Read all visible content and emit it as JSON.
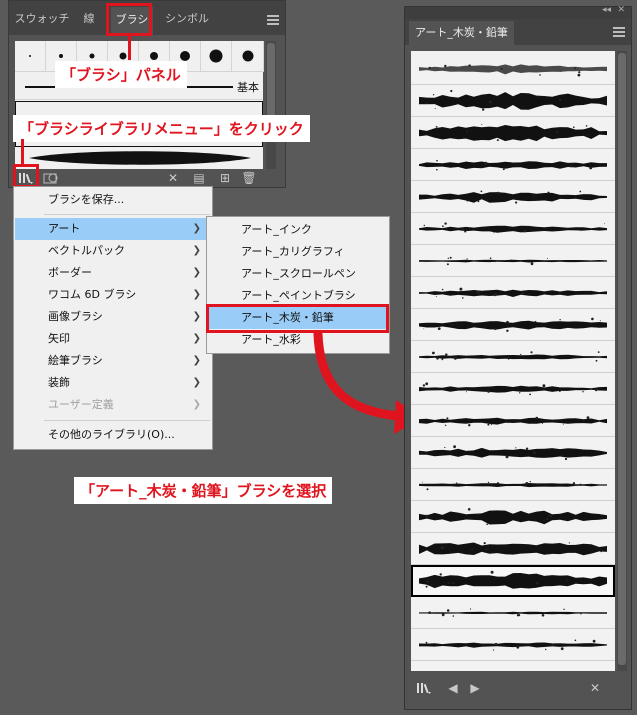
{
  "brush_panel": {
    "tabs": [
      "スウォッチ",
      "線",
      "ブラシ",
      "シンボル"
    ],
    "basic_label": "基本"
  },
  "menu": {
    "items": [
      {
        "label": "ブラシを保存...",
        "submenu": false
      },
      {
        "label": "アート",
        "submenu": true,
        "highlighted": true
      },
      {
        "label": "ベクトルパック",
        "submenu": true
      },
      {
        "label": "ボーダー",
        "submenu": true
      },
      {
        "label": "ワコム 6D ブラシ",
        "submenu": true
      },
      {
        "label": "画像ブラシ",
        "submenu": true
      },
      {
        "label": "矢印",
        "submenu": true
      },
      {
        "label": "絵筆ブラシ",
        "submenu": true
      },
      {
        "label": "装飾",
        "submenu": true
      },
      {
        "label": "ユーザー定義",
        "submenu": true,
        "disabled": true
      },
      {
        "label": "その他のライブラリ(O)...",
        "submenu": false
      }
    ],
    "submenu_items": [
      "アート_インク",
      "アート_カリグラフィ",
      "アート_スクロールペン",
      "アート_ペイントブラシ",
      "アート_木炭・鉛筆",
      "アート_水彩"
    ],
    "selected_submenu_index": 4
  },
  "callouts": {
    "brush_panel": "「ブラシ」パネル",
    "library_menu": "「ブラシライブラリメニュー」をクリック",
    "select_brush": "「アート_木炭・鉛筆」ブラシを選択"
  },
  "right_panel": {
    "tab_title": "アート_木炭・鉛筆",
    "selected_row": 16
  },
  "colors": {
    "annotation_red": "#e0141e",
    "menu_highlight": "#99ccf7",
    "panel_bg": "#535353"
  },
  "icons": [
    "brush-library-menu-icon",
    "brush-libraries-icon",
    "remove-stroke-icon",
    "options-icon",
    "new-brush-icon",
    "trash-icon",
    "prev-library-icon",
    "next-library-icon",
    "panel-menu-icon"
  ]
}
